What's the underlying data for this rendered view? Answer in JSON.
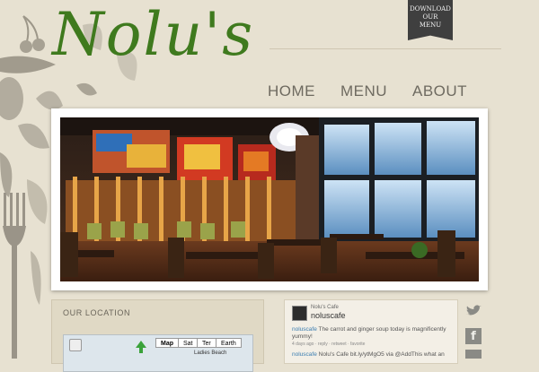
{
  "logo": {
    "text": "Nolu's"
  },
  "download_ribbon": {
    "line1": "DOWNLOAD",
    "line2": "OUR",
    "line3": "MENU"
  },
  "nav": {
    "items": [
      "HOME",
      "MENU",
      "ABOUT"
    ]
  },
  "location_panel": {
    "title": "OUR LOCATION",
    "map": {
      "buttons": [
        "Map",
        "Sat",
        "Ter",
        "Earth"
      ],
      "place_label": "Ladies Beach"
    }
  },
  "twitter": {
    "display_name": "Nolu's Cafe",
    "handle": "noluscafe",
    "tweet1_user": "noluscafe",
    "tweet1_text": " The carrot and ginger soup today is magnificently yummy!",
    "tweet1_meta": "4 days ago · reply · retweet · favorite",
    "tweet2_user": "noluscafe",
    "tweet2_text": " Nolu's Cafe bit.ly/ytMgO5 via @AddThis what an"
  },
  "colors": {
    "background": "#e7e1d1",
    "logo_green": "#3f7a1e",
    "ribbon": "#3f3f3f",
    "nav_text": "#6e6a60"
  },
  "icons": [
    "download-ribbon",
    "twitter-bird-icon",
    "facebook-icon",
    "youtube-icon"
  ]
}
